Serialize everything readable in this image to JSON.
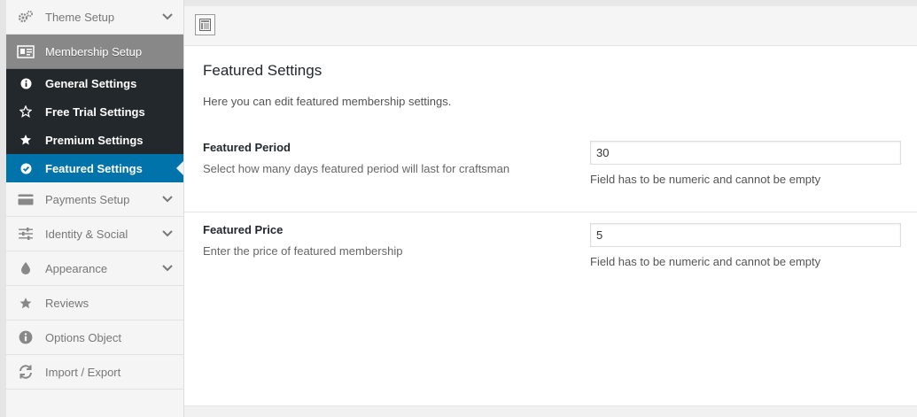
{
  "sidebar": {
    "theme_setup": "Theme Setup",
    "membership_setup": "Membership Setup",
    "sub_items": [
      {
        "label": "General Settings",
        "icon": "info-icon"
      },
      {
        "label": "Free Trial Settings",
        "icon": "star-outline-icon"
      },
      {
        "label": "Premium Settings",
        "icon": "star-icon"
      },
      {
        "label": "Featured Settings",
        "icon": "check-circle-icon"
      }
    ],
    "payments_setup": "Payments Setup",
    "identity_social": "Identity & Social",
    "appearance": "Appearance",
    "reviews": "Reviews",
    "options_object": "Options Object",
    "import_export": "Import / Export"
  },
  "main": {
    "section_title": "Featured Settings",
    "section_desc": "Here you can edit featured membership settings.",
    "fields": [
      {
        "title": "Featured Period",
        "subtitle": "Select how many days featured period will last for craftsman",
        "value": "30",
        "hint": "Field has to be numeric and cannot be empty"
      },
      {
        "title": "Featured Price",
        "subtitle": "Enter the price of featured membership",
        "value": "5",
        "hint": "Field has to be numeric and cannot be empty"
      }
    ]
  },
  "colors": {
    "active_blue": "#0073aa",
    "submenu_dark": "#23282d",
    "active_header": "#888888"
  }
}
